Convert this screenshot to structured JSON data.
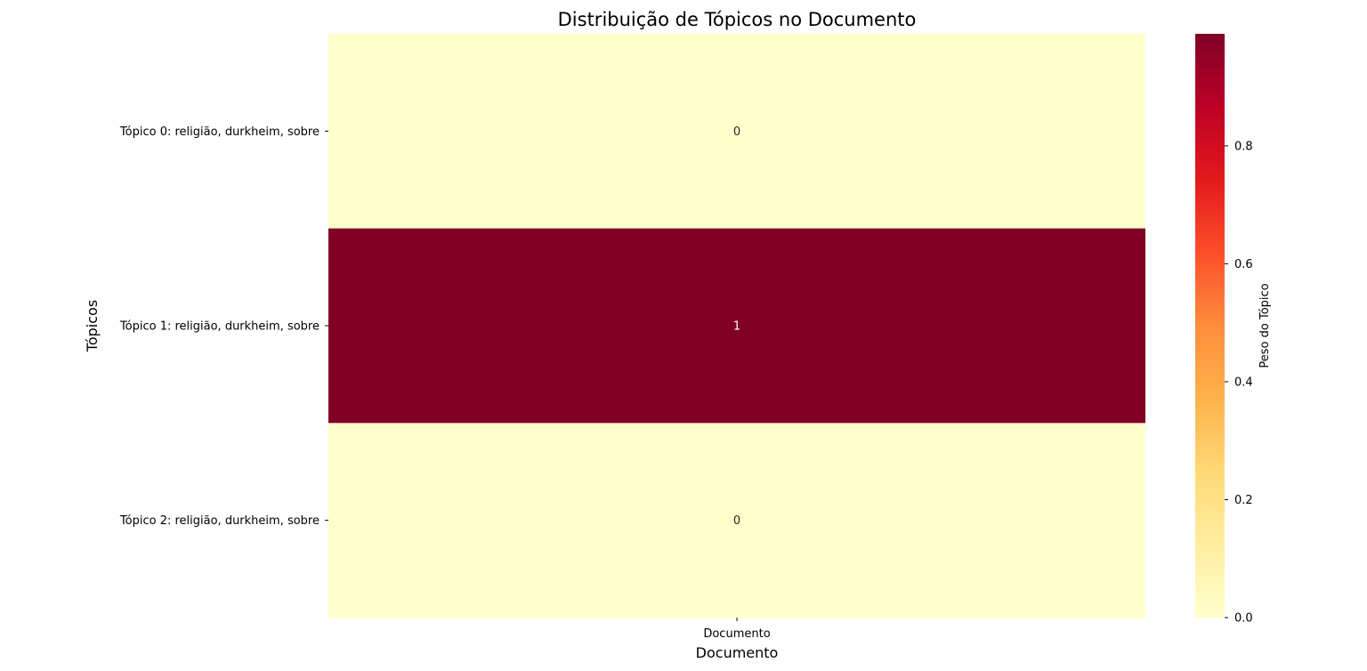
{
  "chart_data": {
    "type": "heatmap",
    "title": "Distribuição de Tópicos no Documento",
    "xlabel": "Documento",
    "ylabel": "Tópicos",
    "x_categories": [
      "Documento"
    ],
    "y_categories": [
      "Tópico 0: religião, durkheim, sobre",
      "Tópico 1: religião, durkheim, sobre",
      "Tópico 2: religião, durkheim, sobre"
    ],
    "values": [
      [
        0.0
      ],
      [
        0.99
      ],
      [
        0.0
      ]
    ],
    "annotations": [
      [
        "0"
      ],
      [
        "1"
      ],
      [
        "0"
      ]
    ],
    "colorbar": {
      "label": "Peso do Tópico",
      "colormap": "YlOrRd",
      "range": [
        0,
        0.99
      ],
      "ticks": [
        0.0,
        0.2,
        0.4,
        0.6,
        0.8
      ],
      "tick_labels": [
        "0.0",
        "0.2",
        "0.4",
        "0.6",
        "0.8"
      ]
    },
    "colors": {
      "low": "#ffffcc",
      "high": "#800026",
      "text_on_low": "#262626",
      "text_on_high": "#ffffff"
    }
  }
}
